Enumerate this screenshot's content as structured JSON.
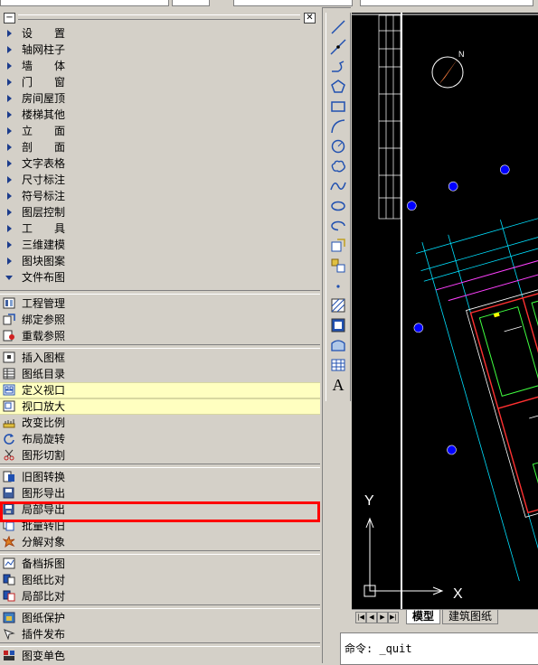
{
  "palette": {
    "minimize_label": "−",
    "close_label": "✕",
    "categories": [
      {
        "label": "设　　置"
      },
      {
        "label": "轴网柱子"
      },
      {
        "label": "墙　　体"
      },
      {
        "label": "门　　窗"
      },
      {
        "label": "房间屋顶"
      },
      {
        "label": "楼梯其他"
      },
      {
        "label": "立　　面"
      },
      {
        "label": "剖　　面"
      },
      {
        "label": "文字表格"
      },
      {
        "label": "尺寸标注"
      },
      {
        "label": "符号标注"
      },
      {
        "label": "图层控制"
      },
      {
        "label": "工　　具"
      },
      {
        "label": "三维建模"
      },
      {
        "label": "图块图案"
      },
      {
        "label": "文件布图"
      }
    ],
    "commands": [
      {
        "label": "工程管理",
        "icon": "project-manager-icon"
      },
      {
        "label": "绑定参照",
        "icon": "bind-xref-icon"
      },
      {
        "label": "重载参照",
        "icon": "reload-xref-icon"
      },
      {
        "label": "插入图框",
        "icon": "insert-frame-icon"
      },
      {
        "label": "图纸目录",
        "icon": "drawing-index-icon"
      },
      {
        "label": "定义视口",
        "icon": "define-viewport-icon"
      },
      {
        "label": "视口放大",
        "icon": "viewport-zoom-icon"
      },
      {
        "label": "改变比例",
        "icon": "change-scale-icon"
      },
      {
        "label": "布局旋转",
        "icon": "layout-rotate-icon"
      },
      {
        "label": "图形切割",
        "icon": "graphic-cut-icon"
      },
      {
        "label": "旧图转换",
        "icon": "old-drawing-convert-icon"
      },
      {
        "label": "图形导出",
        "icon": "graphic-export-icon"
      },
      {
        "label": "局部导出",
        "icon": "partial-export-icon"
      },
      {
        "label": "批量转旧",
        "icon": "batch-convert-icon"
      },
      {
        "label": "分解对象",
        "icon": "explode-object-icon"
      },
      {
        "label": "备档拆图",
        "icon": "archive-split-icon"
      },
      {
        "label": "图纸比对",
        "icon": "drawing-compare-icon"
      },
      {
        "label": "局部比对",
        "icon": "partial-compare-icon"
      },
      {
        "label": "图纸保护",
        "icon": "drawing-protect-icon"
      },
      {
        "label": "插件发布",
        "icon": "plugin-publish-icon"
      },
      {
        "label": "图变单色",
        "icon": "monochrome-icon"
      }
    ]
  },
  "draw_toolbar": [
    "line-icon",
    "construction-line-icon",
    "polyline-icon",
    "polygon-icon",
    "rectangle-icon",
    "arc-icon",
    "circle-icon",
    "revision-cloud-icon",
    "spline-icon",
    "ellipse-icon",
    "ellipse-arc-icon",
    "insert-block-icon",
    "make-block-icon",
    "point-icon",
    "hatch-icon",
    "gradient-icon",
    "region-icon",
    "table-icon",
    "multiline-text-icon"
  ],
  "text_tool_label": "A",
  "compass_label": "N",
  "ucs": {
    "y_label": "Y",
    "x_label": "X"
  },
  "layout_tabs": {
    "model": "模型",
    "layout": "建筑图纸"
  },
  "command_line": {
    "text": "命令: _quit"
  },
  "colors": {
    "highlight_row": "#ffffc0",
    "red_box": "#ff0000",
    "canvas_bg": "#000000"
  }
}
